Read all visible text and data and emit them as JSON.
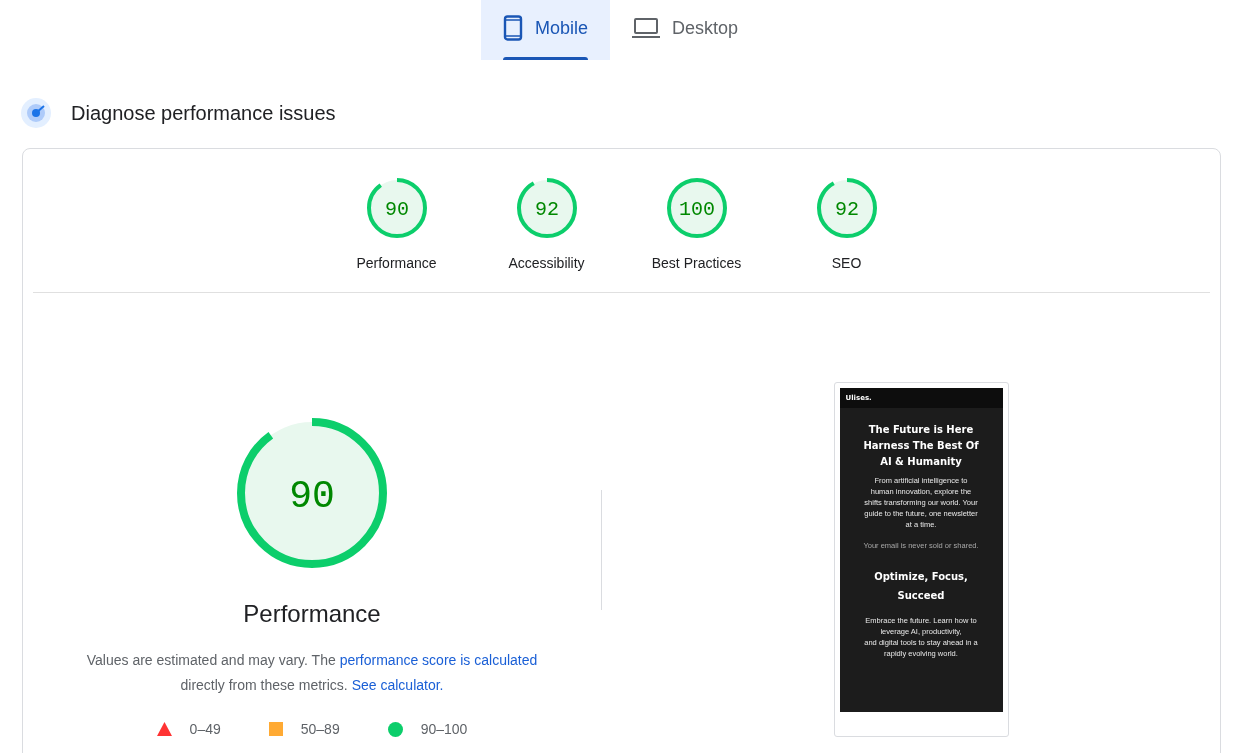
{
  "tabs": [
    {
      "label": "Mobile",
      "selected": true
    },
    {
      "label": "Desktop",
      "selected": false
    }
  ],
  "section": {
    "title": "Diagnose performance issues"
  },
  "categories": [
    {
      "score": "90",
      "label": "Performance"
    },
    {
      "score": "92",
      "label": "Accessibility"
    },
    {
      "score": "100",
      "label": "Best Practices"
    },
    {
      "score": "92",
      "label": "SEO"
    }
  ],
  "performance": {
    "score": "90",
    "title": "Performance",
    "description": [
      {
        "kind": "text",
        "text": "Values are estimated and may vary. The "
      },
      {
        "kind": "link",
        "text": "performance score is calculated"
      },
      {
        "kind": "text",
        "text": " directly from these metrics. "
      },
      {
        "kind": "link",
        "text": "See calculator."
      }
    ],
    "legend": [
      {
        "kind": "triangle",
        "label": "0–49",
        "color": "#ff3333"
      },
      {
        "kind": "square",
        "label": "50–89",
        "color": "#ffaa33"
      },
      {
        "kind": "circle",
        "label": "90–100",
        "color": "#0cce6b"
      }
    ]
  },
  "preview": {
    "site_name": "Ulises.",
    "headline_lines": [
      "The Future is Here",
      "Harness The Best Of",
      "AI & Humanity"
    ],
    "intro_lines": [
      "From artificial intelligence to",
      "human innovation, explore the",
      "shifts transforming our world. Your",
      "guide to the future, one newsletter",
      "at a time."
    ],
    "note": "Your email is never sold or shared.",
    "subheading_lines": [
      "Optimize, Focus,",
      "Succeed"
    ],
    "body_lines": [
      "Embrace the future. Learn how to",
      "leverage AI, productivity,",
      "and digital tools to stay ahead in a",
      "rapidly evolving world."
    ]
  }
}
